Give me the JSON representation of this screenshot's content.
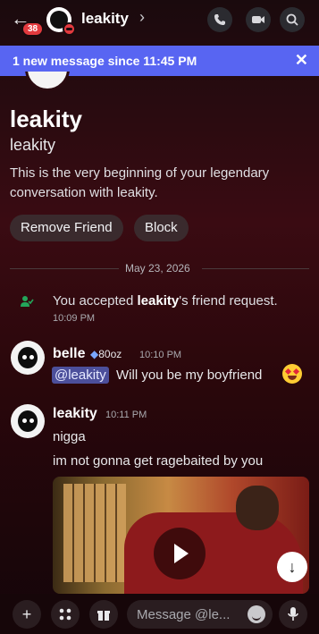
{
  "header": {
    "unread_badge": "38",
    "title": "leakity",
    "chevron": "›"
  },
  "banner": {
    "text": "1 new message since 11:45 PM",
    "close": "✕"
  },
  "profile": {
    "display_name": "leakity",
    "username": "leakity",
    "intro": "This is the very beginning of your legendary conversation with leakity.",
    "buttons": [
      "Remove Friend",
      "Block"
    ]
  },
  "date_divider": "May 23, 2026",
  "system_message": {
    "prefix": "You accepted ",
    "name": "leakity",
    "suffix": "'s friend request.",
    "time": "10:09 PM"
  },
  "messages": [
    {
      "author": "belle",
      "tag": "80oz",
      "time": "10:10 PM",
      "mention": "@leakity",
      "text": "Will you be my boyfriend"
    },
    {
      "author": "leakity",
      "time": "10:11 PM",
      "lines": [
        "nigga",
        "im not gonna get ragebaited by you"
      ]
    }
  ],
  "composer": {
    "placeholder": "Message @le..."
  },
  "icons": [
    "back-arrow-icon",
    "voice-call-icon",
    "video-call-icon",
    "search-icon",
    "close-icon",
    "friend-accept-icon",
    "play-icon",
    "jump-down-icon",
    "plus-icon",
    "apps-icon",
    "gift-icon",
    "emoji-icon",
    "mic-icon"
  ],
  "colors": {
    "banner": "#5865f2",
    "dnd": "#e23a3e",
    "mention_bg": "#4c4f9b"
  }
}
